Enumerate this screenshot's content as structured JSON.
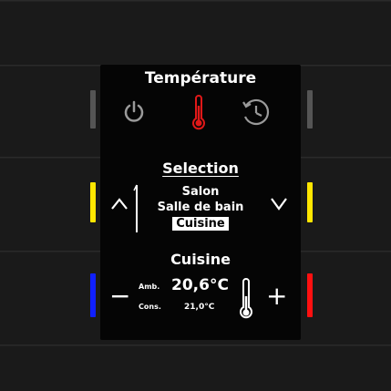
{
  "screen": {
    "title": "Température",
    "selection": {
      "title": "Selection",
      "items": [
        "Salon",
        "Salle de bain",
        "Cuisine"
      ],
      "selected_index": 2
    },
    "room": {
      "name": "Cuisine",
      "amb_label": "Amb.",
      "amb_value": "20,6°C",
      "cons_label": "Cons.",
      "cons_value": "21,0°C",
      "minus": "−",
      "plus": "+"
    },
    "icons": [
      "power-icon",
      "thermometer-icon",
      "schedule-icon",
      "up-arrow-icon",
      "down-arrow-icon",
      "thermometer-icon"
    ]
  },
  "indicators": {
    "row1": "#555555",
    "row2": "#ffe600",
    "row3_left": "#1020ff",
    "row3_right": "#ff1010"
  }
}
